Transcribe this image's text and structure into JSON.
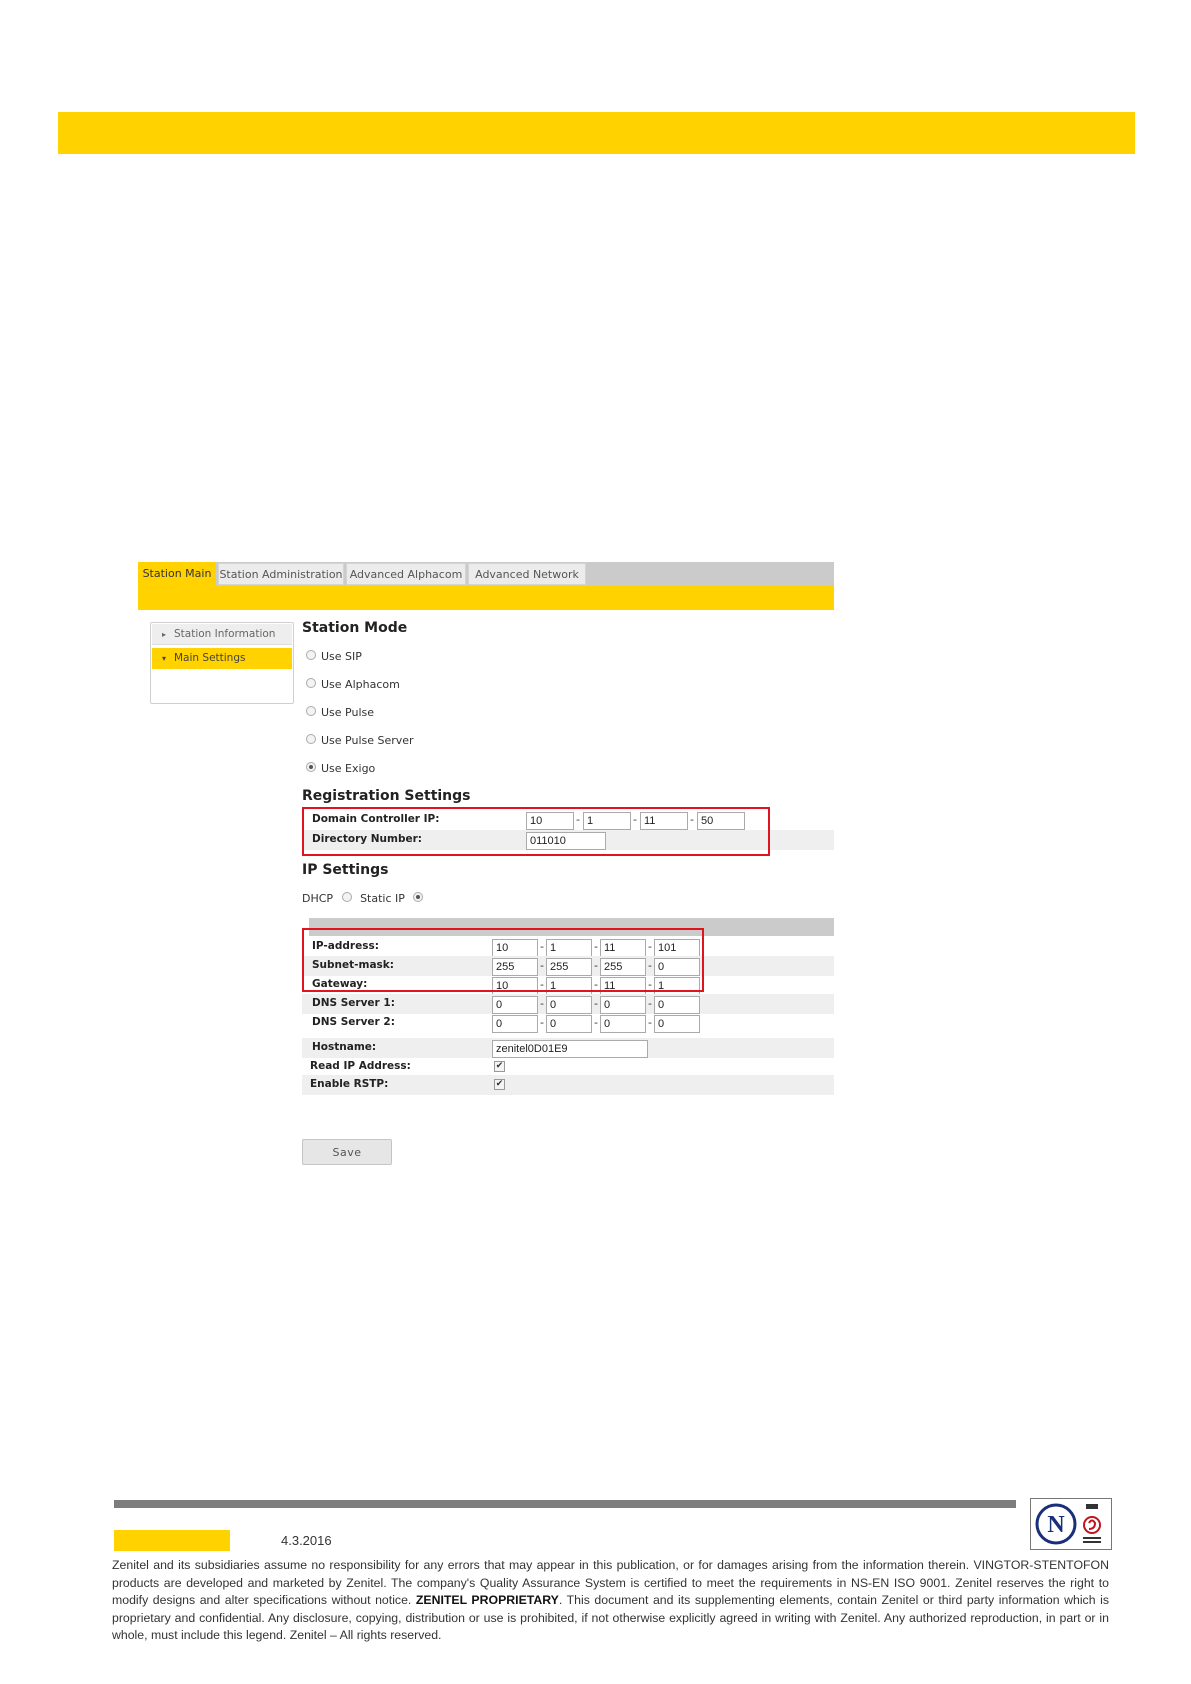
{
  "tabs": [
    {
      "label": "Station Main",
      "active": true
    },
    {
      "label": "Station Administration",
      "active": false
    },
    {
      "label": "Advanced Alphacom",
      "active": false
    },
    {
      "label": "Advanced Network",
      "active": false
    }
  ],
  "sidebar": {
    "items": [
      {
        "label": "Station Information",
        "active": false
      },
      {
        "label": "Main Settings",
        "active": true
      }
    ]
  },
  "station_mode": {
    "heading": "Station Mode",
    "options": [
      {
        "label": "Use SIP",
        "checked": false
      },
      {
        "label": "Use Alphacom",
        "checked": false
      },
      {
        "label": "Use Pulse",
        "checked": false
      },
      {
        "label": "Use Pulse Server",
        "checked": false
      },
      {
        "label": "Use Exigo",
        "checked": true
      }
    ]
  },
  "registration": {
    "heading": "Registration Settings",
    "domain_controller_label": "Domain Controller IP:",
    "domain_controller_ip": [
      "10",
      "1",
      "11",
      "50"
    ],
    "directory_number_label": "Directory Number:",
    "directory_number": "011010"
  },
  "ip_settings": {
    "heading": "IP Settings",
    "dhcp_label": "DHCP",
    "static_label": "Static IP",
    "mode": "static",
    "rows": [
      {
        "label": "IP-address:",
        "octets": [
          "10",
          "1",
          "11",
          "101"
        ]
      },
      {
        "label": "Subnet-mask:",
        "octets": [
          "255",
          "255",
          "255",
          "0"
        ]
      },
      {
        "label": "Gateway:",
        "octets": [
          "10",
          "1",
          "11",
          "1"
        ]
      },
      {
        "label": "DNS Server 1:",
        "octets": [
          "0",
          "0",
          "0",
          "0"
        ]
      },
      {
        "label": "DNS Server 2:",
        "octets": [
          "0",
          "0",
          "0",
          "0"
        ]
      }
    ],
    "hostname_label": "Hostname:",
    "hostname": "zenitel0D01E9",
    "read_ip_label": "Read IP Address:",
    "read_ip_checked": true,
    "rstp_label": "Enable RSTP:",
    "rstp_checked": true
  },
  "save_label": "Save",
  "footer": {
    "date": "4.3.2016",
    "legal_1": "Zenitel and its subsidiaries assume no responsibility for any errors that may appear in this publication, or for damages arising from the information therein. VINGTOR-STENTOFON products are developed and marketed by Zenitel. The company's Quality Assurance System is certified to meet the requirements in NS-EN ISO 9001. Zenitel reserves the right to modify designs and alter specifications without notice.",
    "legal_bold": "ZENITEL PROPRIETARY",
    "legal_2": ". This document and its supplementing elements, contain Zenitel or third party information which is proprietary and confidential. Any disclosure, copying, distribution or use is prohibited, if not otherwise explicitly agreed in writing with Zenitel. Any authorized reproduction, in part or in whole, must include this legend. Zenitel – All rights reserved.",
    "logo_letter": "N"
  },
  "colors": {
    "accent_yellow": "#ffd200",
    "highlight_red": "#e0141e",
    "footer_gray": "#7d7d7d"
  }
}
